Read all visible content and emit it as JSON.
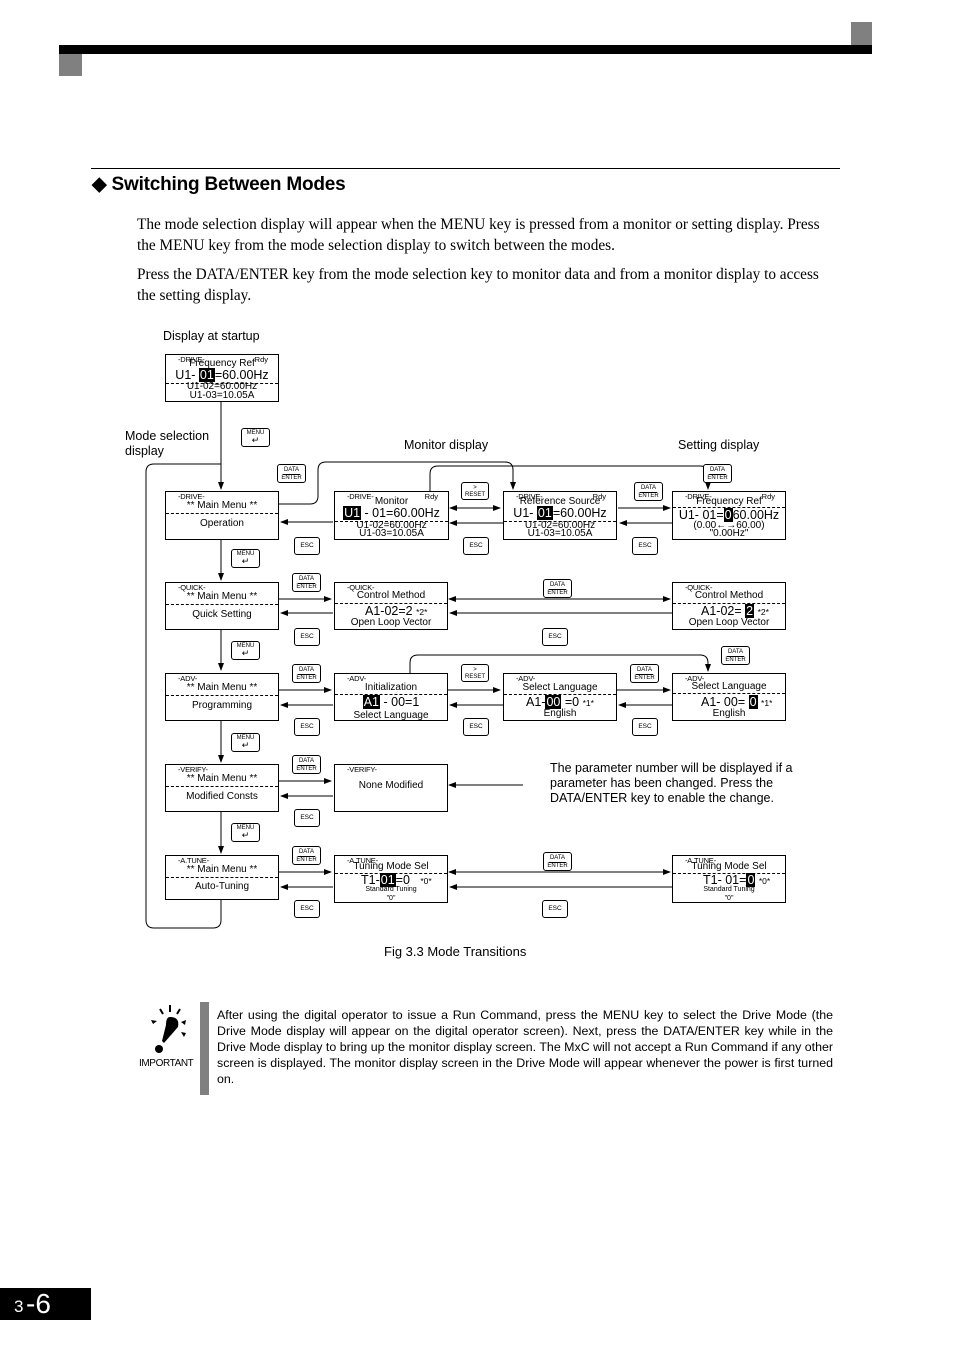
{
  "section": {
    "title": "Switching Between Modes",
    "bullet_icon": "diamond",
    "paragraphs": [
      "The mode selection display will appear when the MENU key is pressed from a monitor or setting display. Press the MENU key from the mode selection display to switch between the modes.",
      "Press the DATA/ENTER key from the mode selection key to monitor data and from a monitor display to access the setting display."
    ]
  },
  "diagram": {
    "labels": {
      "startup": "Display at startup",
      "mode_selection": "Mode selection display",
      "monitor": "Monitor display",
      "setting": "Setting display"
    },
    "keys": {
      "data_top": "DATA",
      "data_bottom": "ENTER",
      "esc": "ESC",
      "menu": "MENU",
      "reset_top": ">",
      "reset_bottom": "RESET"
    },
    "startup_panel": {
      "mode": "-DRIVE-",
      "rdy": "Rdy",
      "line1": "Frequency Ref",
      "line2_pre": "U1- ",
      "line2_hl": "01",
      "line2_post": "=60.00Hz",
      "line3": "U1-02=60.00Hz",
      "line4": "U1-03=10.05A"
    },
    "rows": [
      {
        "menu": {
          "mode": "-DRIVE-",
          "title": "** Main Menu **",
          "name": "Operation"
        },
        "monitor": {
          "mode": "-DRIVE-",
          "rdy": "Rdy",
          "line1": "Monitor",
          "hl": "U1",
          "post": " - 01=60.00Hz",
          "line3": "U1-02=60.00Hz",
          "line4": "U1-03=10.05A"
        },
        "monitor2": {
          "mode": "-DRIVE-",
          "rdy": "Rdy",
          "line1": "Reference Source",
          "pre": "U1- ",
          "hl": "01",
          "post": "=60.00Hz",
          "line3": "U1-02=60.00Hz",
          "line4": "U1-03=10.05A"
        },
        "setting": {
          "mode": "-DRIVE-",
          "rdy": "Rdy",
          "line1": "Frequency Ref",
          "pre": "U1- 01=",
          "hl": "0",
          "post": "60.00Hz",
          "line3": "(0.00←→60.00)",
          "line4": "\"0.00Hz\""
        }
      },
      {
        "menu": {
          "mode": "-QUICK-",
          "title": "** Main Menu **",
          "name": "Quick Setting"
        },
        "monitor": {
          "mode": "-QUICK-",
          "line1": "Control Method",
          "value": "A1-02=2",
          "tag": "*2*",
          "line3": "Open Loop Vector"
        },
        "setting": {
          "mode": "-QUICK-",
          "line1": "Control Method",
          "pre": "A1-02= ",
          "hl": "2",
          "tag": "*2*",
          "line3": "Open Loop Vector"
        }
      },
      {
        "menu": {
          "mode": "-ADV-",
          "title": "** Main Menu **",
          "name": "Programming"
        },
        "monitor": {
          "mode": "-ADV-",
          "line1": "Initialization",
          "hl": "A1",
          "post": " - 00=1",
          "line3": "Select Language"
        },
        "monitor2": {
          "mode": "-ADV-",
          "line1": "Select Language",
          "pre": "A1-",
          "hl": "00",
          "post": " =0",
          "tag": "*1*",
          "line3": "English"
        },
        "setting": {
          "mode": "-ADV-",
          "line1": "Select Language",
          "pre": "A1- 00= ",
          "hl": "0",
          "tag": "*1*",
          "line3": "English"
        }
      },
      {
        "menu": {
          "mode": "-VERIFY-",
          "title": "** Main Menu **",
          "name": "Modified Consts"
        },
        "monitor": {
          "mode": "-VERIFY-",
          "line1": "None Modified"
        }
      },
      {
        "menu": {
          "mode": "-A.TUNE-",
          "title": "** Main Menu **",
          "name": "Auto-Tuning"
        },
        "monitor": {
          "mode": "-A.TUNE-",
          "line1": "Tuning Mode Sel",
          "pre": "T1-",
          "hl": "01",
          "post": "=0",
          "tag": "*0*",
          "line3": "Standard Tuning",
          "line4": "\"0\""
        },
        "setting": {
          "mode": "-A.TUNE-",
          "line1": "Tuning Mode Sel",
          "pre": "T1- 01=",
          "hl": "0",
          "tag": "*0*",
          "line3": "Standard Tuning",
          "line4": "\"0\""
        }
      }
    ],
    "note": "The parameter number will be displayed if a parameter has been changed. Press the DATA/ENTER key to enable the change.",
    "caption": "Fig 3.3  Mode Transitions"
  },
  "important": {
    "label": "IMPORTANT",
    "text": "After using the digital operator to issue a Run Command, press the MENU key to select the Drive Mode (the Drive Mode display will appear on the digital operator screen). Next, press the DATA/ENTER key while in the Drive Mode display to bring up the monitor display screen. The MxC will not accept a Run Command if any other screen is displayed. The monitor display screen in the Drive Mode will appear whenever the power is first turned on."
  },
  "page_number": {
    "chapter": "3",
    "page": "-6"
  }
}
